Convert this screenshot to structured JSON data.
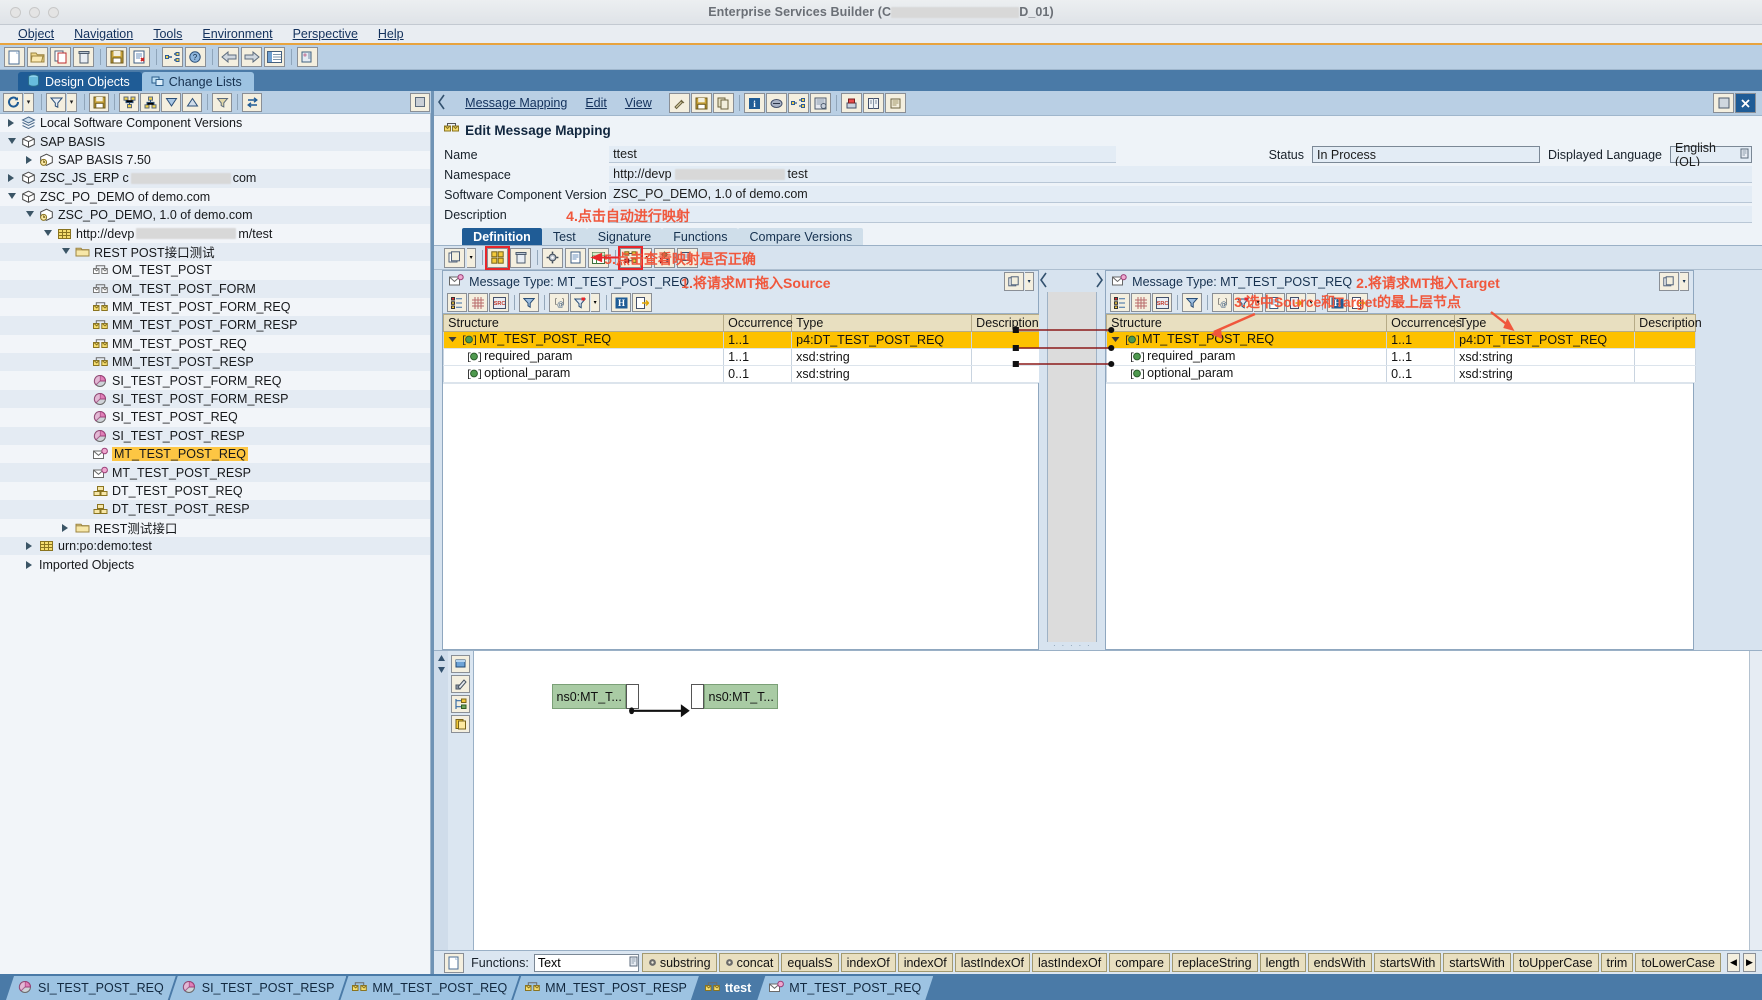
{
  "window": {
    "title_prefix": "Enterprise Services Builder (C",
    "title_suffix": "D_01)"
  },
  "menubar": {
    "items": [
      "Object",
      "Navigation",
      "Tools",
      "Environment",
      "Perspective",
      "Help"
    ]
  },
  "main_toolbar": {
    "buttons": [
      {
        "name": "new-icon",
        "glyph": "⬜"
      },
      {
        "name": "open-folder-icon",
        "glyph": "📂"
      },
      {
        "name": "copy-icon",
        "glyph": "❐"
      },
      {
        "name": "delete-trash-icon",
        "glyph": "🗑"
      },
      {
        "name": "save-icon",
        "glyph": "💾"
      },
      {
        "name": "check-document-icon",
        "glyph": "📃"
      },
      {
        "name": "where-used-icon",
        "glyph": "↔"
      },
      {
        "name": "help-object-icon",
        "glyph": "❓"
      },
      {
        "name": "back-arrow-icon",
        "glyph": "←"
      },
      {
        "name": "forward-arrow-icon",
        "glyph": "→"
      },
      {
        "name": "list-view-icon",
        "glyph": "☰"
      },
      {
        "name": "admin-icon",
        "glyph": "⚙"
      }
    ]
  },
  "design_tabs": [
    {
      "label": "Design Objects",
      "icon": "cylinder-icon",
      "active": true
    },
    {
      "label": "Change Lists",
      "icon": "changelist-icon",
      "active": false
    }
  ],
  "tree_toolbar": {
    "buttons": [
      "refresh-icon",
      "filter-icon",
      "save-icon",
      "expand-all-icon",
      "collapse-all-icon",
      "move-down-icon",
      "move-up-icon",
      "funnel-icon",
      "switch-icon"
    ]
  },
  "tree": {
    "items": [
      {
        "label": "Local Software Component Versions",
        "indent": 0,
        "twisty": "right",
        "icon": "stack-icon"
      },
      {
        "label": "SAP BASIS",
        "indent": 0,
        "twisty": "down",
        "icon": "package-icon"
      },
      {
        "label": "SAP BASIS 7.50",
        "indent": 1,
        "twisty": "right",
        "icon": "version-icon"
      },
      {
        "label": "ZSC_JS_ERP c",
        "label2": "com",
        "indent": 0,
        "twisty": "right",
        "icon": "package-icon",
        "redacted": true
      },
      {
        "label": "ZSC_PO_DEMO of demo.com",
        "indent": 0,
        "twisty": "down",
        "icon": "package-icon"
      },
      {
        "label": "ZSC_PO_DEMO, 1.0 of demo.com",
        "indent": 1,
        "twisty": "down",
        "icon": "version-icon"
      },
      {
        "label": "http://devp",
        "label2": "m/test",
        "indent": 2,
        "twisty": "down",
        "icon": "namespace-icon",
        "redacted": true
      },
      {
        "label": "REST POST接口测试",
        "indent": 3,
        "twisty": "down",
        "icon": "folder-icon"
      },
      {
        "label": "OM_TEST_POST",
        "indent": 4,
        "twisty": "none",
        "icon": "operation-mapping-icon"
      },
      {
        "label": "OM_TEST_POST_FORM",
        "indent": 4,
        "twisty": "none",
        "icon": "operation-mapping-icon"
      },
      {
        "label": "MM_TEST_POST_FORM_REQ",
        "indent": 4,
        "twisty": "none",
        "icon": "message-mapping-icon"
      },
      {
        "label": "MM_TEST_POST_FORM_RESP",
        "indent": 4,
        "twisty": "none",
        "icon": "message-mapping-icon"
      },
      {
        "label": "MM_TEST_POST_REQ",
        "indent": 4,
        "twisty": "none",
        "icon": "message-mapping-icon"
      },
      {
        "label": "MM_TEST_POST_RESP",
        "indent": 4,
        "twisty": "none",
        "icon": "message-mapping-icon"
      },
      {
        "label": "SI_TEST_POST_FORM_REQ",
        "indent": 4,
        "twisty": "none",
        "icon": "service-interface-icon"
      },
      {
        "label": "SI_TEST_POST_FORM_RESP",
        "indent": 4,
        "twisty": "none",
        "icon": "service-interface-icon"
      },
      {
        "label": "SI_TEST_POST_REQ",
        "indent": 4,
        "twisty": "none",
        "icon": "service-interface-icon"
      },
      {
        "label": "SI_TEST_POST_RESP",
        "indent": 4,
        "twisty": "none",
        "icon": "service-interface-icon"
      },
      {
        "label": "MT_TEST_POST_REQ",
        "indent": 4,
        "twisty": "none",
        "icon": "message-type-icon",
        "selected": true
      },
      {
        "label": "MT_TEST_POST_RESP",
        "indent": 4,
        "twisty": "none",
        "icon": "message-type-icon"
      },
      {
        "label": "DT_TEST_POST_REQ",
        "indent": 4,
        "twisty": "none",
        "icon": "data-type-icon"
      },
      {
        "label": "DT_TEST_POST_RESP",
        "indent": 4,
        "twisty": "none",
        "icon": "data-type-icon"
      },
      {
        "label": "REST测试接口",
        "indent": 3,
        "twisty": "right",
        "icon": "folder-icon"
      },
      {
        "label": "urn:po:demo:test",
        "indent": 1,
        "twisty": "right",
        "icon": "namespace-icon"
      },
      {
        "label": "Imported Objects",
        "indent": 1,
        "twisty": "right",
        "icon": "none"
      }
    ]
  },
  "editor": {
    "menu": [
      "Message Mapping",
      "Edit",
      "View"
    ],
    "toolbar_buttons": [
      "tools-icon",
      "save-icon",
      "copy-icon",
      "info-icon",
      "check-icon",
      "where-used-icon",
      "history-icon",
      "print-icon",
      "book-icon",
      "scroll-icon"
    ],
    "title": "Edit Message Mapping",
    "title_icon": "message-mapping-icon",
    "fields": [
      {
        "label": "Name",
        "value": "ttest"
      },
      {
        "label": "Namespace",
        "value": "http://devp",
        "value2": "test",
        "redacted": true
      },
      {
        "label": "Software Component Version",
        "value": "ZSC_PO_DEMO, 1.0 of demo.com"
      },
      {
        "label": "Description",
        "value": ""
      }
    ],
    "status_label": "Status",
    "status_value": "In Process",
    "language_label": "Displayed Language",
    "language_value": "English (OL)",
    "tabs": [
      {
        "label": "Definition",
        "active": true
      },
      {
        "label": "Test",
        "active": false
      },
      {
        "label": "Signature",
        "active": false
      },
      {
        "label": "Functions",
        "active": false
      },
      {
        "label": "Compare Versions",
        "active": false
      }
    ],
    "map_toolbar": [
      "new-window-icon",
      "auto-map-icon",
      "delete-icon",
      "settings-icon",
      "document-icon",
      "table-icon",
      "dependency-icon",
      "value-map-icon",
      "display-queue-icon"
    ]
  },
  "source_pane": {
    "header": "Message Type: MT_TEST_POST_REQ",
    "header_icon": "message-type-icon",
    "toolbar": [
      "structure-icon",
      "grid-icon",
      "src-icon",
      "filter-icon",
      "context-icon",
      "funnel-icon",
      "find-icon",
      "export-icon"
    ],
    "columns": [
      "Structure",
      "Occurrence",
      "Type",
      "Description"
    ],
    "rows": [
      {
        "structure": "MT_TEST_POST_REQ",
        "occurrence": "1..1",
        "type": "p4:DT_TEST_POST_REQ",
        "description": "",
        "depth": 0,
        "expanded": true,
        "selected": true
      },
      {
        "structure": "required_param",
        "occurrence": "1..1",
        "type": "xsd:string",
        "description": "",
        "depth": 1,
        "expanded": false,
        "selected": false
      },
      {
        "structure": "optional_param",
        "occurrence": "0..1",
        "type": "xsd:string",
        "description": "",
        "depth": 1,
        "expanded": false,
        "selected": false
      }
    ]
  },
  "target_pane": {
    "header": "Message Type: MT_TEST_POST_REQ",
    "header_icon": "message-type-icon",
    "toolbar": [
      "structure-icon",
      "grid-icon",
      "src-icon",
      "filter-icon",
      "context-icon",
      "funnel-icon",
      "document-icon",
      "export-opts-icon",
      "find-icon",
      "export-icon"
    ],
    "columns": [
      "Structure",
      "Occurrences",
      "Type",
      "Description"
    ],
    "rows": [
      {
        "structure": "MT_TEST_POST_REQ",
        "occurrence": "1..1",
        "type": "p4:DT_TEST_POST_REQ",
        "description": "",
        "depth": 0,
        "expanded": true,
        "selected": true
      },
      {
        "structure": "required_param",
        "occurrence": "1..1",
        "type": "xsd:string",
        "description": "",
        "depth": 1,
        "expanded": false,
        "selected": false
      },
      {
        "structure": "optional_param",
        "occurrence": "0..1",
        "type": "xsd:string",
        "description": "",
        "depth": 1,
        "expanded": false,
        "selected": false
      }
    ]
  },
  "graph": {
    "tools": [
      "select-icon",
      "eraser-icon",
      "layout-icon",
      "clipboard-icon"
    ],
    "source_node": "ns0:MT_T...",
    "target_node": "ns0:MT_T..."
  },
  "functions_bar": {
    "icon": "new-function-icon",
    "label": "Functions:",
    "selected_category": "Text",
    "buttons": [
      {
        "label": "substring",
        "has_icon": true
      },
      {
        "label": "concat",
        "has_icon": true
      },
      {
        "label": "equalsS",
        "has_icon": false
      },
      {
        "label": "indexOf",
        "has_icon": false
      },
      {
        "label": "indexOf",
        "has_icon": false
      },
      {
        "label": "lastIndexOf",
        "has_icon": false
      },
      {
        "label": "lastIndexOf",
        "has_icon": false
      },
      {
        "label": "compare",
        "has_icon": false
      },
      {
        "label": "replaceString",
        "has_icon": false
      },
      {
        "label": "length",
        "has_icon": false
      },
      {
        "label": "endsWith",
        "has_icon": false
      },
      {
        "label": "startsWith",
        "has_icon": false
      },
      {
        "label": "startsWith",
        "has_icon": false
      },
      {
        "label": "toUpperCase",
        "has_icon": false
      },
      {
        "label": "trim",
        "has_icon": false
      },
      {
        "label": "toLowerCase",
        "has_icon": false
      }
    ],
    "nav_prev": "◀",
    "nav_next": "▶"
  },
  "doc_tabs": [
    {
      "label": "SI_TEST_POST_REQ",
      "icon": "service-interface-icon",
      "active": false
    },
    {
      "label": "SI_TEST_POST_RESP",
      "icon": "service-interface-icon",
      "active": false
    },
    {
      "label": "MM_TEST_POST_REQ",
      "icon": "message-mapping-icon",
      "active": false
    },
    {
      "label": "MM_TEST_POST_RESP",
      "icon": "message-mapping-icon",
      "active": false
    },
    {
      "label": "ttest",
      "icon": "message-mapping-icon",
      "active": true
    },
    {
      "label": "MT_TEST_POST_REQ",
      "icon": "message-type-icon",
      "active": false
    }
  ],
  "annotations": [
    {
      "id": "a4",
      "text": "4.点击自动进行映射"
    },
    {
      "id": "a5",
      "text": "5.点击查看映射是否正确"
    },
    {
      "id": "a1",
      "text": "1.将请求MT拖入Source"
    },
    {
      "id": "a2",
      "text": "2.将请求MT拖入Target"
    },
    {
      "id": "a3",
      "text": "3.选中Source和Target的最上层节点"
    }
  ],
  "colors": {
    "accent_blue": "#1f5c96",
    "panel_blue": "#b9cfe4",
    "selection_gold": "#fdc100",
    "annotation_red": "#f0573c",
    "header_tan": "#e8dfc0"
  }
}
